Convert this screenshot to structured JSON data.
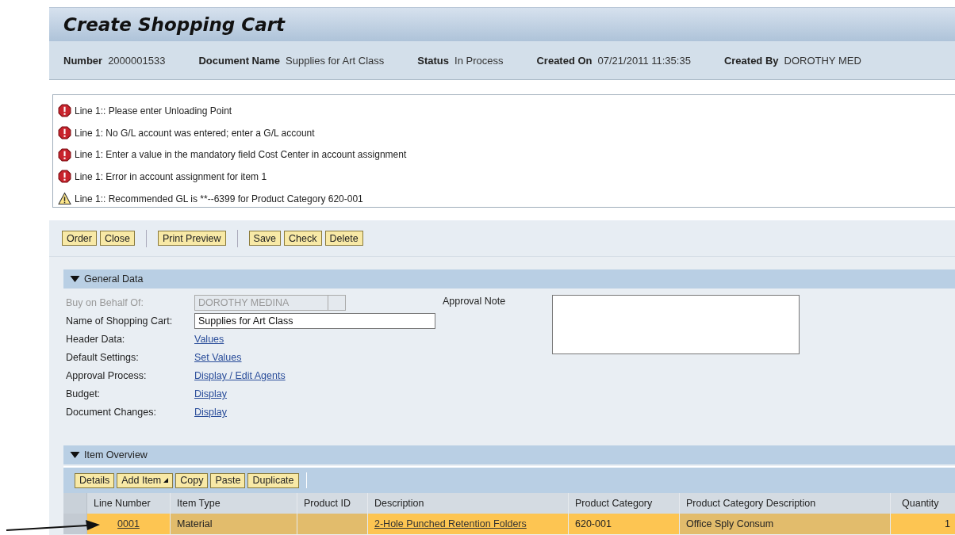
{
  "page": {
    "title": "Create Shopping Cart"
  },
  "header_fields": [
    {
      "label": "Number",
      "value": "2000001533"
    },
    {
      "label": "Document Name",
      "value": "Supplies for Art Class"
    },
    {
      "label": "Status",
      "value": "In Process"
    },
    {
      "label": "Created On",
      "value": "07/21/2011 11:35:35"
    },
    {
      "label": "Created By",
      "value": "DOROTHY MED"
    }
  ],
  "messages": [
    {
      "kind": "error",
      "text": "Line 1:: Please enter Unloading Point"
    },
    {
      "kind": "error",
      "text": "Line 1: No G/L account was entered; enter a G/L account"
    },
    {
      "kind": "error",
      "text": "Line 1: Enter a value in the mandatory field Cost Center in account assignment"
    },
    {
      "kind": "error",
      "text": "Line 1: Error in account assignment for item 1"
    },
    {
      "kind": "warning",
      "text": "Line 1:: Recommended GL is **--6399 for Product Category 620-001"
    }
  ],
  "toolbar": [
    [
      "Order",
      "Close"
    ],
    [
      "Print Preview"
    ],
    [
      "Save",
      "Check",
      "Delete"
    ]
  ],
  "general_data": {
    "title": "General Data",
    "expanded": true,
    "fields": [
      {
        "kind": "input",
        "label": "Buy on Behalf Of:",
        "value": "DOROTHY MEDINA",
        "disabled": true
      },
      {
        "kind": "input",
        "label": "Name of Shopping Cart:",
        "value": "Supplies for Art Class",
        "disabled": false
      },
      {
        "kind": "link",
        "label": "Header Data:",
        "value": "Values"
      },
      {
        "kind": "link",
        "label": "Default Settings:",
        "value": "Set Values"
      },
      {
        "kind": "link",
        "label": "Approval Process:",
        "value": "Display / Edit Agents"
      },
      {
        "kind": "link",
        "label": "Budget:",
        "value": "Display"
      },
      {
        "kind": "link",
        "label": "Document Changes:",
        "value": "Display"
      }
    ],
    "approval_note": {
      "label": "Approval Note"
    }
  },
  "item_overview": {
    "title": "Item Overview",
    "expanded": true,
    "toolbar": [
      {
        "label": "Details",
        "menu": false
      },
      {
        "label": "Add Item",
        "menu": true
      },
      {
        "label": "Copy",
        "menu": false
      },
      {
        "label": "Paste",
        "menu": false
      },
      {
        "label": "Duplicate",
        "menu": false
      }
    ],
    "columns": [
      "Line Number",
      "Item Type",
      "Product ID",
      "Description",
      "Product Category",
      "Product Category Description",
      "Quantity"
    ],
    "rows": [
      {
        "selected": true,
        "line_number": "0001",
        "item_type": "Material",
        "product_id": "",
        "description": "2-Hole Punched Retention Folders",
        "product_category": "620-001",
        "product_category_description": "Office Sply Consum",
        "quantity": "1"
      }
    ]
  }
}
